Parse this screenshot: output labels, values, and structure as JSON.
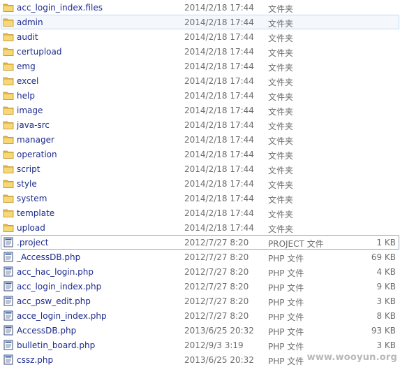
{
  "folder_type_label": "文件夹",
  "folders": [
    {
      "name": "acc_login_index.files",
      "date": "2014/2/18 17:44"
    },
    {
      "name": "admin",
      "date": "2014/2/18 17:44"
    },
    {
      "name": "audit",
      "date": "2014/2/18 17:44"
    },
    {
      "name": "certupload",
      "date": "2014/2/18 17:44"
    },
    {
      "name": "emg",
      "date": "2014/2/18 17:44"
    },
    {
      "name": "excel",
      "date": "2014/2/18 17:44"
    },
    {
      "name": "help",
      "date": "2014/2/18 17:44"
    },
    {
      "name": "image",
      "date": "2014/2/18 17:44"
    },
    {
      "name": "java-src",
      "date": "2014/2/18 17:44"
    },
    {
      "name": "manager",
      "date": "2014/2/18 17:44"
    },
    {
      "name": "operation",
      "date": "2014/2/18 17:44"
    },
    {
      "name": "script",
      "date": "2014/2/18 17:44"
    },
    {
      "name": "style",
      "date": "2014/2/18 17:44"
    },
    {
      "name": "system",
      "date": "2014/2/18 17:44"
    },
    {
      "name": "template",
      "date": "2014/2/18 17:44"
    },
    {
      "name": "upload",
      "date": "2014/2/18 17:44"
    }
  ],
  "files": [
    {
      "name": ".project",
      "date": "2012/7/27 8:20",
      "type": "PROJECT 文件",
      "size": "1 KB"
    },
    {
      "name": "_AccessDB.php",
      "date": "2012/7/27 8:20",
      "type": "PHP 文件",
      "size": "69 KB"
    },
    {
      "name": "acc_hac_login.php",
      "date": "2012/7/27 8:20",
      "type": "PHP 文件",
      "size": "4 KB"
    },
    {
      "name": "acc_login_index.php",
      "date": "2012/7/27 8:20",
      "type": "PHP 文件",
      "size": "9 KB"
    },
    {
      "name": "acc_psw_edit.php",
      "date": "2012/7/27 8:20",
      "type": "PHP 文件",
      "size": "3 KB"
    },
    {
      "name": "acce_login_index.php",
      "date": "2012/7/27 8:20",
      "type": "PHP 文件",
      "size": "8 KB"
    },
    {
      "name": "AccessDB.php",
      "date": "2013/6/25 20:32",
      "type": "PHP 文件",
      "size": "93 KB"
    },
    {
      "name": "bulletin_board.php",
      "date": "2012/9/3 3:19",
      "type": "PHP 文件",
      "size": "3 KB"
    },
    {
      "name": "cssz.php",
      "date": "2013/6/25 20:32",
      "type": "PHP 文件",
      "size": ""
    }
  ],
  "hover_row": "admin",
  "focus_row": ".project",
  "watermark": "www.wooyun.org"
}
